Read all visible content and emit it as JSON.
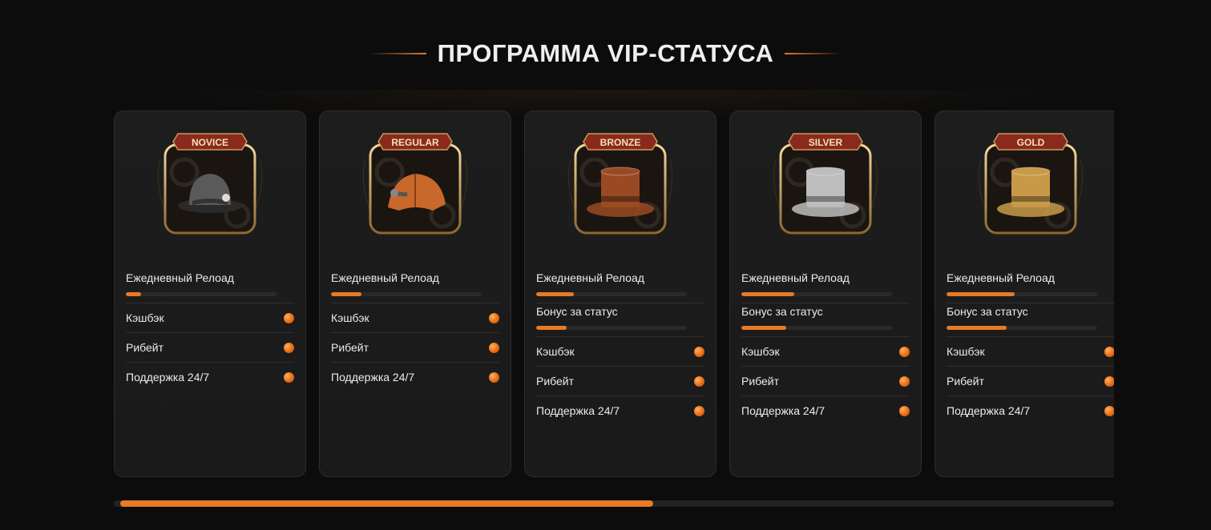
{
  "section": {
    "title": "ПРОГРАММА VIP-СТАТУСА"
  },
  "colors": {
    "accent": "#e87a26",
    "card_bg": "#1d1d1d",
    "page_bg": "#0c0c0c"
  },
  "levels": [
    {
      "badge": "NOVICE",
      "hat": "bowler-hat",
      "hat_color": "#5a5a5a",
      "perks": [
        {
          "label": "Ежедневный Релоад",
          "type": "bar",
          "progress": 0.1
        },
        {
          "label": "Кэшбэк",
          "type": "dot"
        },
        {
          "label": "Рибейт",
          "type": "dot"
        },
        {
          "label": "Поддержка 24/7",
          "type": "dot"
        }
      ]
    },
    {
      "badge": "REGULAR",
      "hat": "deerstalker-hat",
      "hat_color": "#c8682a",
      "perks": [
        {
          "label": "Ежедневный Релоад",
          "type": "bar",
          "progress": 0.2
        },
        {
          "label": "Кэшбэк",
          "type": "dot"
        },
        {
          "label": "Рибейт",
          "type": "dot"
        },
        {
          "label": "Поддержка 24/7",
          "type": "dot"
        }
      ]
    },
    {
      "badge": "BRONZE",
      "hat": "top-hat",
      "hat_color": "#9a4a22",
      "perks": [
        {
          "label": "Ежедневный Релоад",
          "type": "bar",
          "progress": 0.25
        },
        {
          "label": "Бонус за статус",
          "type": "bar",
          "progress": 0.2
        },
        {
          "label": "Кэшбэк",
          "type": "dot"
        },
        {
          "label": "Рибейт",
          "type": "dot"
        },
        {
          "label": "Поддержка 24/7",
          "type": "dot"
        }
      ]
    },
    {
      "badge": "SILVER",
      "hat": "top-hat",
      "hat_color": "#bdbdbd",
      "perks": [
        {
          "label": "Ежедневный Релоад",
          "type": "bar",
          "progress": 0.35
        },
        {
          "label": "Бонус за статус",
          "type": "bar",
          "progress": 0.3
        },
        {
          "label": "Кэшбэк",
          "type": "dot"
        },
        {
          "label": "Рибейт",
          "type": "dot"
        },
        {
          "label": "Поддержка 24/7",
          "type": "dot"
        }
      ]
    },
    {
      "badge": "GOLD",
      "hat": "top-hat",
      "hat_color": "#c89a48",
      "perks": [
        {
          "label": "Ежедневный Релоад",
          "type": "bar",
          "progress": 0.45
        },
        {
          "label": "Бонус за статус",
          "type": "bar",
          "progress": 0.4
        },
        {
          "label": "Кэшбэк",
          "type": "dot"
        },
        {
          "label": "Рибейт",
          "type": "dot"
        },
        {
          "label": "Поддержка 24/7",
          "type": "dot"
        }
      ]
    }
  ],
  "carousel": {
    "scroll_progress": 0.54
  }
}
